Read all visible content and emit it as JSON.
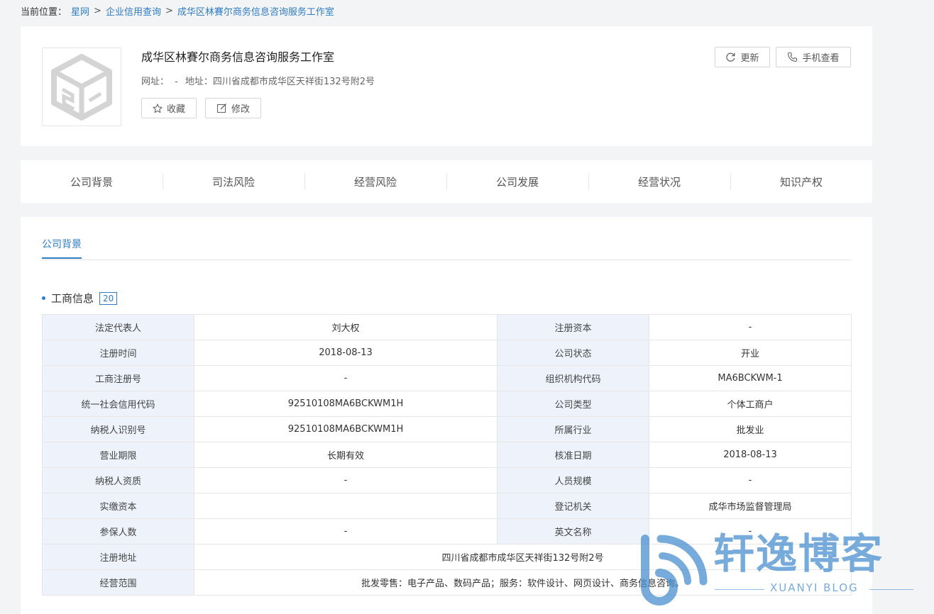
{
  "breadcrumb": {
    "prefix": "当前位置：",
    "items": [
      "星网",
      "企业信用查询",
      "成华区林賽尔商务信息咨询服务工作室"
    ],
    "separator": ">"
  },
  "company": {
    "name": "成华区林賽尔商务信息咨询服务工作室",
    "website_label": "网址：",
    "website_value": "-",
    "address_label": "地址：",
    "address_value": "四川省成都市成华区天祥街132号附2号",
    "logo_icon": "box-icon"
  },
  "actions": {
    "favorite": "收藏",
    "edit": "修改",
    "update": "更新",
    "mobile": "手机查看"
  },
  "tabs": [
    "公司背景",
    "司法风险",
    "经营风险",
    "公司发展",
    "经营状况",
    "知识产权"
  ],
  "subtab": "公司背景",
  "section": {
    "title": "工商信息",
    "count": "20"
  },
  "info_rows": [
    [
      "法定代表人",
      "刘大权",
      "注册资本",
      "-"
    ],
    [
      "注册时间",
      "2018-08-13",
      "公司状态",
      "开业"
    ],
    [
      "工商注册号",
      "-",
      "组织机构代码",
      "MA6BCKWM-1"
    ],
    [
      "统一社会信用代码",
      "92510108MA6BCKWM1H",
      "公司类型",
      "个体工商户"
    ],
    [
      "纳税人识别号",
      "92510108MA6BCKWM1H",
      "所属行业",
      "批发业"
    ],
    [
      "营业期限",
      "长期有效",
      "核准日期",
      "2018-08-13"
    ],
    [
      "纳税人资质",
      "-",
      "人员规模",
      "-"
    ],
    [
      "实缴资本",
      "",
      "登记机关",
      "成华市场监督管理局"
    ],
    [
      "参保人数",
      "-",
      "英文名称",
      "-"
    ]
  ],
  "wide_rows": [
    [
      "注册地址",
      "四川省成都市成华区天祥街132号附2号"
    ],
    [
      "经营范围",
      "批发零售：电子产品、数码产品；服务：软件设计、网页设计、商务信息咨询。"
    ]
  ],
  "watermark": {
    "title": "轩逸博客",
    "subtitle": "XUANYI BLOG"
  },
  "colors": {
    "accent": "#2f7cc2",
    "label_bg": "#eef3fb",
    "page_bg": "#f3f4f6"
  }
}
